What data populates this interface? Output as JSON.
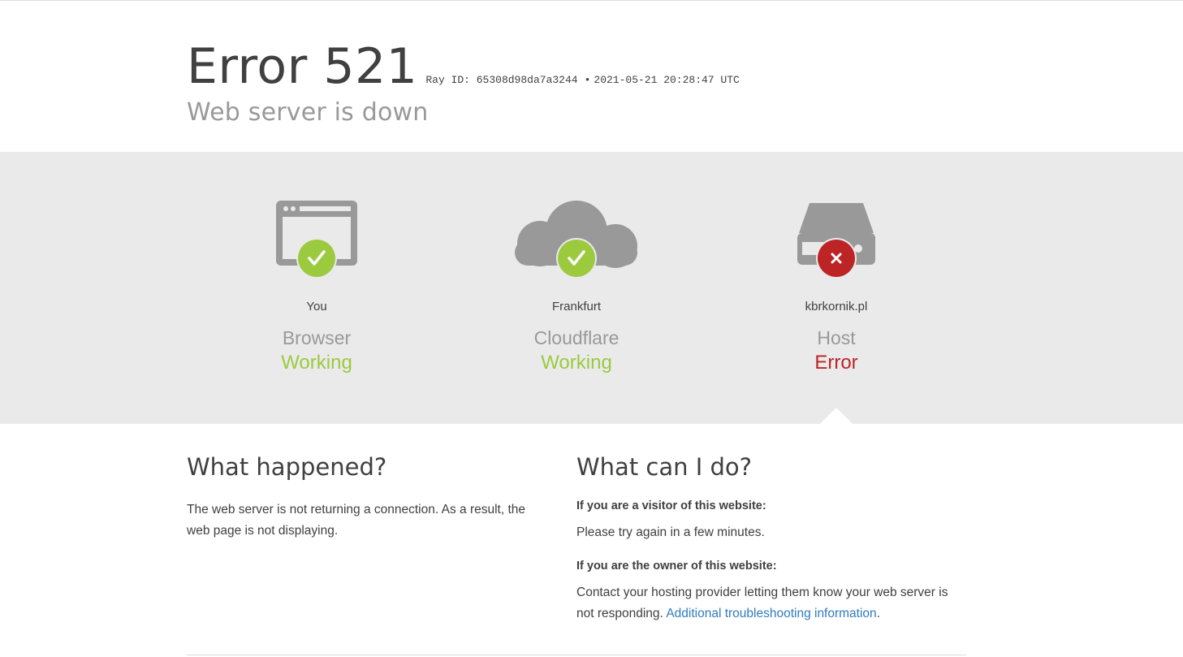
{
  "header": {
    "error_title": "Error 521",
    "ray_label": "Ray ID: 65308d98da7a3244",
    "separator": "•",
    "timestamp": "2021-05-21 20:28:47 UTC",
    "subtitle": "Web server is down"
  },
  "nodes": [
    {
      "icon": "browser-window-icon",
      "badge": "check-icon",
      "location": "You",
      "role": "Browser",
      "status": "Working",
      "status_color": "#9bca3e"
    },
    {
      "icon": "cloud-icon",
      "badge": "check-icon",
      "location": "Frankfurt",
      "role": "Cloudflare",
      "status": "Working",
      "status_color": "#9bca3e"
    },
    {
      "icon": "server-icon",
      "badge": "x-icon",
      "location": "kbrkornik.pl",
      "role": "Host",
      "status": "Error",
      "status_color": "#bd2426"
    }
  ],
  "what_happened": {
    "heading": "What happened?",
    "body": "The web server is not returning a connection. As a result, the web page is not displaying."
  },
  "what_can_i_do": {
    "heading": "What can I do?",
    "visitor_heading": "If you are a visitor of this website:",
    "visitor_body": "Please try again in a few minutes.",
    "owner_heading": "If you are the owner of this website:",
    "owner_body": "Contact your hosting provider letting them know your web server is not responding.",
    "owner_link": "Additional troubleshooting information",
    "owner_suffix": "."
  },
  "colors": {
    "ok": "#9bca3e",
    "error": "#bd2426",
    "icon_gray": "#999999",
    "band_bg": "#eaeaea",
    "link": "#2f7bbf"
  }
}
